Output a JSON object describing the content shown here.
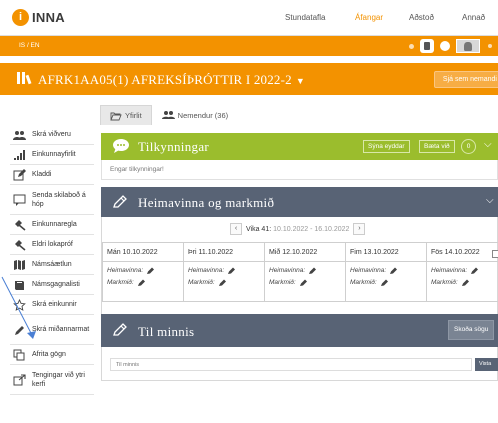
{
  "app": {
    "name": "INNA"
  },
  "topnav": [
    {
      "label": "Stundatafla",
      "active": false
    },
    {
      "label": "Áfangar",
      "active": true
    },
    {
      "label": "Aðstoð",
      "active": false
    },
    {
      "label": "Annað",
      "active": false
    }
  ],
  "language": "IS / EN",
  "course": {
    "title": "AFRK1AA05(1) AFREKSÍÞRÓTTIR I 2022-2",
    "see_as": "Sjá sem nemandi"
  },
  "tabs": [
    {
      "label": "Yfirlit",
      "active": true
    },
    {
      "label": "Nemendur (36)",
      "active": false
    }
  ],
  "sidebar": {
    "items": [
      {
        "label": "Skrá viðveru",
        "icon": "users-icon"
      },
      {
        "label": "Einkunnayfirlit",
        "icon": "bar-chart-icon"
      },
      {
        "label": "Kladdi",
        "icon": "edit-icon"
      },
      {
        "label": "Senda skilaboð á hóp",
        "icon": "message-icon"
      },
      {
        "label": "Einkunnaregla",
        "icon": "gavel-icon"
      },
      {
        "label": "Eldri lokapróf",
        "icon": "gavel-icon"
      },
      {
        "label": "Námsáætlun",
        "icon": "map-icon"
      },
      {
        "label": "Námsgagnalisti",
        "icon": "book-icon"
      },
      {
        "label": "Skrá einkunnir",
        "icon": "star-icon"
      },
      {
        "label": "Skrá miðannarmat",
        "icon": "pencil-icon"
      },
      {
        "label": "Afrita gögn",
        "icon": "copy-icon"
      },
      {
        "label": "Tengingar við ytri kerfi",
        "icon": "external-link-icon"
      }
    ]
  },
  "announcements": {
    "title": "Tilkynningar",
    "show_deleted": "Sýna eyddar",
    "add": "Bæta við",
    "count": "0",
    "empty_text": "Engar tilkynningar!",
    "accent": "#9bbd2d"
  },
  "homework": {
    "title": "Heimavinna og markmið",
    "week_label": "Vika 41:",
    "week_range": "10.10.2022 - 16.10.2022",
    "homework_label": "Heimavinna:",
    "goal_label": "Markmið:",
    "days": [
      {
        "label": "Mán 10.10.2022"
      },
      {
        "label": "Þri 11.10.2022"
      },
      {
        "label": "Mið 12.10.2022"
      },
      {
        "label": "Fim 13.10.2022"
      },
      {
        "label": "Fös 14.10.2022"
      }
    ],
    "header_color": "#586375"
  },
  "memo": {
    "title": "Til minnis",
    "history_button": "Skoða sögu",
    "input_placeholder": "Til minnis",
    "save_button": "Vista"
  },
  "colors": {
    "brand": "#f39200",
    "panel_dark": "#586375",
    "panel_green": "#9bbd2d",
    "annotation_arrow": "#4a7fd4"
  }
}
